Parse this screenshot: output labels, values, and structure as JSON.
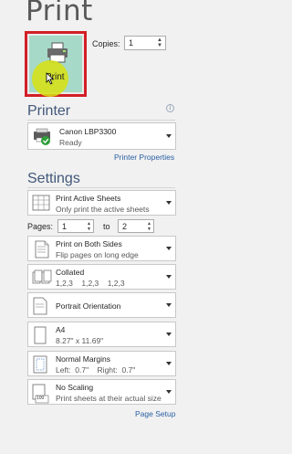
{
  "title": "Print",
  "print_button": {
    "label": "Print"
  },
  "copies": {
    "label": "Copies:",
    "value": "1"
  },
  "printer": {
    "heading": "Printer",
    "info_icon": "i",
    "name": "Canon LBP3300",
    "status": "Ready",
    "properties_link": "Printer Properties"
  },
  "settings": {
    "heading": "Settings",
    "what": {
      "main": "Print Active Sheets",
      "sub": "Only print the active sheets"
    },
    "pages": {
      "label": "Pages:",
      "from": "1",
      "to_label": "to",
      "to": "2"
    },
    "sides": {
      "main": "Print on Both Sides",
      "sub": "Flip pages on long edge"
    },
    "collate": {
      "main": "Collated",
      "sub": "1,2,3    1,2,3    1,2,3"
    },
    "orientation": {
      "main": "Portrait Orientation"
    },
    "paper": {
      "main": "A4",
      "sub": "8.27\" x 11.69\""
    },
    "margins": {
      "main": "Normal Margins",
      "sub": "Left:  0.7\"    Right:  0.7\""
    },
    "scaling": {
      "main": "No Scaling",
      "sub": "Print sheets at their actual size",
      "icon_text": "100"
    },
    "page_setup_link": "Page Setup"
  },
  "colors": {
    "accent_highlight": "#d21f26",
    "section_heading": "#41577a",
    "link": "#2a5fa3",
    "button_bg": "#a7d9c8"
  }
}
